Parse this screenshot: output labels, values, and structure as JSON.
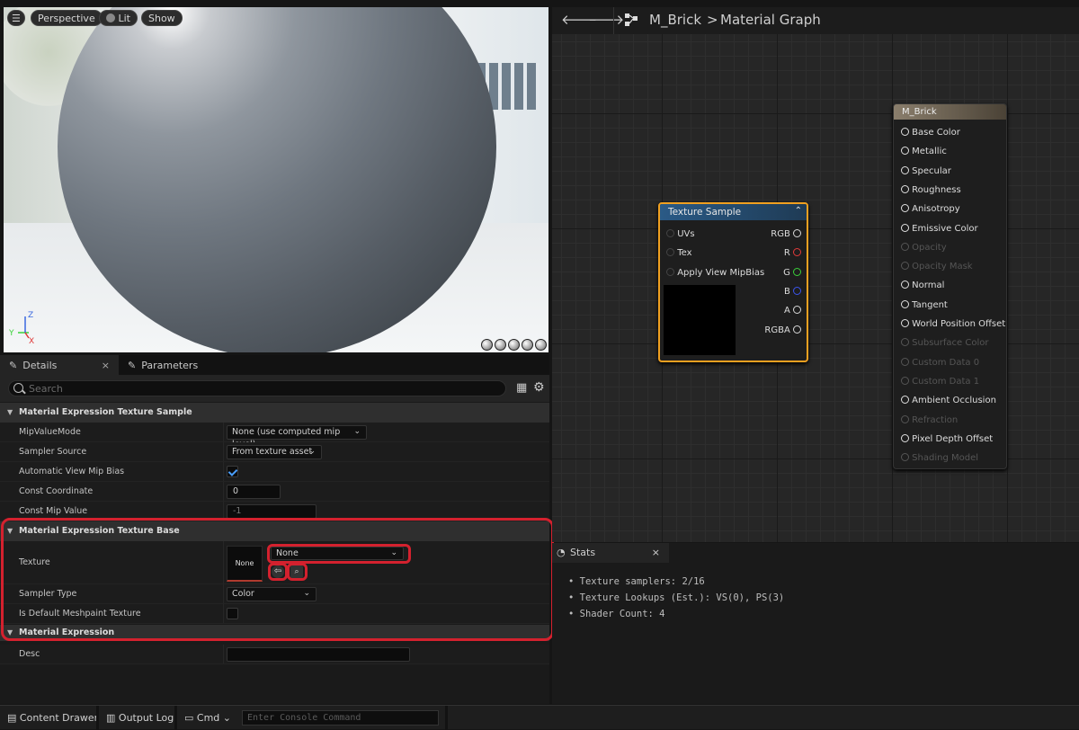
{
  "viewport": {
    "buttons": [
      "Perspective",
      "Lit",
      "Show"
    ],
    "axis_z": "Z",
    "axis_y": "Y",
    "axis_x": "X"
  },
  "details": {
    "tabs": [
      {
        "label": "Details",
        "close": "×"
      },
      {
        "label": "Parameters"
      }
    ],
    "search_placeholder": "Search",
    "sections": [
      {
        "title": "Material Expression Texture Sample",
        "rows": [
          {
            "label": "MipValueMode",
            "value": "None (use computed mip level)"
          },
          {
            "label": "Sampler Source",
            "value": "From texture asset"
          },
          {
            "label": "Automatic View Mip Bias",
            "checked": true
          },
          {
            "label": "Const Coordinate",
            "value": "0"
          },
          {
            "label": "Const Mip Value",
            "value": "-1"
          }
        ]
      },
      {
        "title": "Material Expression Texture Base",
        "rows": [
          {
            "label": "Texture",
            "thumb": "None",
            "value": "None"
          },
          {
            "label": "Sampler Type",
            "value": "Color"
          },
          {
            "label": "Is Default Meshpaint Texture",
            "checked": false
          }
        ]
      },
      {
        "title": "Material Expression",
        "rows": [
          {
            "label": "Desc",
            "value": ""
          }
        ]
      }
    ]
  },
  "graph": {
    "breadcrumb_asset": "M_Brick",
    "breadcrumb_sep": ">",
    "breadcrumb_page": "Material Graph",
    "texture_node": {
      "title": "Texture Sample",
      "inputs": [
        "UVs",
        "Tex",
        "Apply View MipBias"
      ],
      "outputs": [
        {
          "label": "RGB",
          "color": "#d9d9d9"
        },
        {
          "label": "R",
          "color": "#e23a3a"
        },
        {
          "label": "G",
          "color": "#3ad13a"
        },
        {
          "label": "B",
          "color": "#3b55f0"
        },
        {
          "label": "A",
          "color": "#d9d9d9"
        },
        {
          "label": "RGBA",
          "color": "#d9d9d9"
        }
      ]
    },
    "material_node": {
      "title": "M_Brick",
      "pins": [
        {
          "label": "Base Color",
          "enabled": true
        },
        {
          "label": "Metallic",
          "enabled": true
        },
        {
          "label": "Specular",
          "enabled": true
        },
        {
          "label": "Roughness",
          "enabled": true
        },
        {
          "label": "Anisotropy",
          "enabled": true
        },
        {
          "label": "Emissive Color",
          "enabled": true
        },
        {
          "label": "Opacity",
          "enabled": false
        },
        {
          "label": "Opacity Mask",
          "enabled": false
        },
        {
          "label": "Normal",
          "enabled": true
        },
        {
          "label": "Tangent",
          "enabled": true
        },
        {
          "label": "World Position Offset",
          "enabled": true
        },
        {
          "label": "Subsurface Color",
          "enabled": false
        },
        {
          "label": "Custom Data 0",
          "enabled": false
        },
        {
          "label": "Custom Data 1",
          "enabled": false
        },
        {
          "label": "Ambient Occlusion",
          "enabled": true
        },
        {
          "label": "Refraction",
          "enabled": false
        },
        {
          "label": "Pixel Depth Offset",
          "enabled": true
        },
        {
          "label": "Shading Model",
          "enabled": false
        }
      ]
    }
  },
  "stats": {
    "tab": "Stats",
    "close": "×",
    "lines": [
      "Texture samplers: 2/16",
      "Texture Lookups (Est.): VS(0), PS(3)",
      "Shader Count: 4"
    ]
  },
  "bottom": {
    "content_drawer": "Content Drawer",
    "output_log": "Output Log",
    "cmd": "Cmd",
    "console_placeholder": "Enter Console Command"
  },
  "colors": {
    "highlight": "#d4212e",
    "node_selected": "#f0a020",
    "texture_header": "#2a5a86",
    "checkbox_accent": "#4a9eff"
  }
}
